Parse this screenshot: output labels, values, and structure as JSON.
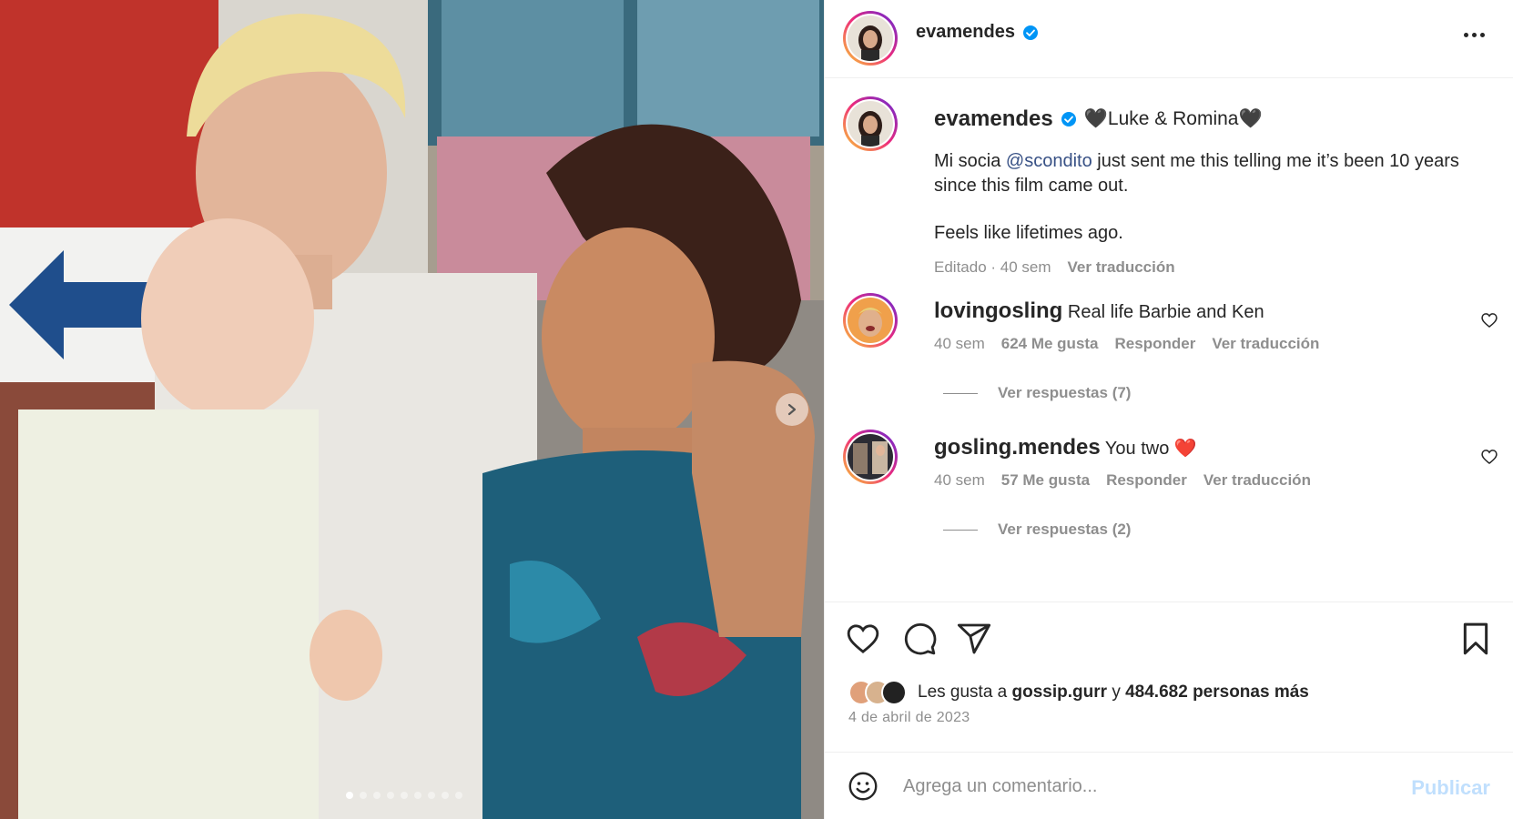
{
  "post": {
    "author": "evamendes",
    "more_icon": "more-horizontal-icon",
    "carousel": {
      "slide_count": 9,
      "active_index": 0,
      "next_icon": "chevron-right-icon"
    }
  },
  "caption": {
    "author": "evamendes",
    "title": "🖤Luke & Romina🖤",
    "text_before_mention": "Mi socia ",
    "mention": "@scondito",
    "text_after_mention": " just sent me this telling me it’s been 10 years since this film came out.",
    "text_line2": "Feels like lifetimes ago.",
    "meta_time": "Editado · 40 sem",
    "translate": "Ver traducción"
  },
  "comments": [
    {
      "user": "lovingosling",
      "text": "Real life Barbie and Ken",
      "time": "40 sem",
      "likes": "624 Me gusta",
      "reply": "Responder",
      "translate": "Ver traducción",
      "replies": "Ver respuestas (7)"
    },
    {
      "user": "gosling.mendes",
      "text": "You two ❤️",
      "time": "40 sem",
      "likes": "57 Me gusta",
      "reply": "Responder",
      "translate": "Ver traducción",
      "replies": "Ver respuestas (2)"
    }
  ],
  "likes": {
    "prefix": "Les gusta a ",
    "user": "gossip.gurr",
    "middle": " y ",
    "count": "484.682 personas más"
  },
  "date": "4 de abril de 2023",
  "comment_box": {
    "placeholder": "Agrega un comentario...",
    "publish": "Publicar"
  },
  "colors": {
    "accent_blue": "#0095f6",
    "publish_disabled": "#c0dffd",
    "verified": "#0095f6",
    "mention": "#385185"
  }
}
